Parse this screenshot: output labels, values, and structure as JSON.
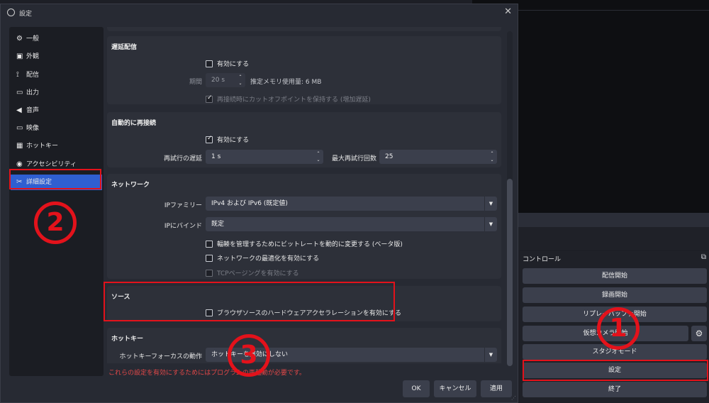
{
  "dialog": {
    "title": "設定",
    "close": "✕"
  },
  "sidebar": {
    "items": [
      {
        "icon": "⚙",
        "label": "一般"
      },
      {
        "icon": "▣",
        "label": "外観"
      },
      {
        "icon": "⟟",
        "label": "配信"
      },
      {
        "icon": "▭",
        "label": "出力"
      },
      {
        "icon": "◀",
        "label": "音声"
      },
      {
        "icon": "▭",
        "label": "映像"
      },
      {
        "icon": "▦",
        "label": "ホットキー"
      },
      {
        "icon": "◉",
        "label": "アクセシビリティ"
      },
      {
        "icon": "✂",
        "label": "詳細設定"
      }
    ]
  },
  "delay": {
    "title": "遅延配信",
    "enable": "有効にする",
    "duration_label": "期間",
    "duration_value": "20 s",
    "estimate": "推定メモリ使用量: 6 MB",
    "preserve": "再接続時にカットオフポイントを保持する (増加遅延)"
  },
  "reconnect": {
    "title": "自動的に再接続",
    "enable": "有効にする",
    "delay_label": "再試行の遅延",
    "delay_value": "1 s",
    "max_label": "最大再試行回数",
    "max_value": "25"
  },
  "network": {
    "title": "ネットワーク",
    "ip_family_label": "IPファミリー",
    "ip_family_value": "IPv4 および IPv6 (既定値)",
    "bind_label": "IPにバインド",
    "bind_value": "既定",
    "dynamic_bitrate": "輻輳を管理するためにビットレートを動的に変更する (ベータ版)",
    "optimize": "ネットワークの最適化を有効にする",
    "tcp_pacing": "TCPページングを有効にする"
  },
  "sources": {
    "title": "ソース",
    "hw_accel": "ブラウザソースのハードウェアアクセラレーションを有効にする"
  },
  "hotkeys": {
    "title": "ホットキー",
    "focus_label": "ホットキーフォーカスの動作",
    "focus_value": "ホットキーを無効にしない"
  },
  "warning": "これらの設定を有効にするためにはプログラムの再起動が必要です。",
  "buttons": {
    "ok": "OK",
    "cancel": "キャンセル",
    "apply": "適用"
  },
  "controls": {
    "title": "コントロール",
    "start_stream": "配信開始",
    "start_record": "録画開始",
    "replay_buffer": "リプレイバッファ開始",
    "virtual_cam": "仮想カメラ開始",
    "studio_mode": "スタジオモード",
    "settings": "設定",
    "exit": "終了"
  },
  "annotations": {
    "one": "1",
    "two": "2",
    "three": "3"
  },
  "colors": {
    "annotation": "#e3121b",
    "accent": "#2f5fd1",
    "warning": "#e24848"
  }
}
